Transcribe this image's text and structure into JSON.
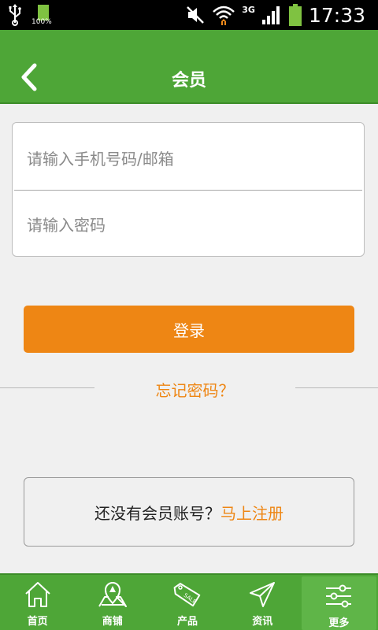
{
  "status_bar": {
    "battery_small_percent": "100%",
    "network": "3G",
    "time": "17:33"
  },
  "header": {
    "title": "会员"
  },
  "form": {
    "account_placeholder": "请输入手机号码/邮箱",
    "password_placeholder": "请输入密码"
  },
  "login": {
    "label": "登录"
  },
  "forgot": {
    "label": "忘记密码？"
  },
  "register": {
    "prompt": "还没有会员账号？",
    "link": "马上注册"
  },
  "tabs": [
    {
      "label": "首页",
      "icon": "home-icon"
    },
    {
      "label": "商铺",
      "icon": "map-pin-icon"
    },
    {
      "label": "产品",
      "icon": "sale-tag-icon"
    },
    {
      "label": "资讯",
      "icon": "paper-plane-icon"
    },
    {
      "label": "更多",
      "icon": "sliders-icon",
      "active": true
    }
  ],
  "colors": {
    "primary_green": "#4ea637",
    "accent_orange": "#ee8614",
    "background": "#f0f0f0"
  }
}
